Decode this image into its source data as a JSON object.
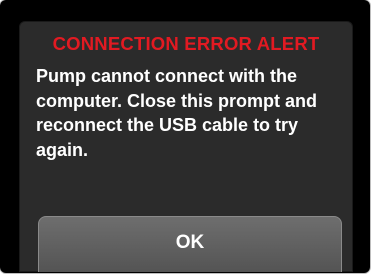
{
  "dialog": {
    "title": "CONNECTION ERROR ALERT",
    "message": "Pump cannot connect with the computer. Close this prompt and reconnect the USB cable to try again.",
    "ok_label": "OK"
  },
  "colors": {
    "title": "#e21a22",
    "text": "#ffffff",
    "screen_background": "#2b2b2b",
    "bezel": "#000000",
    "button": "#5e5e5e"
  }
}
